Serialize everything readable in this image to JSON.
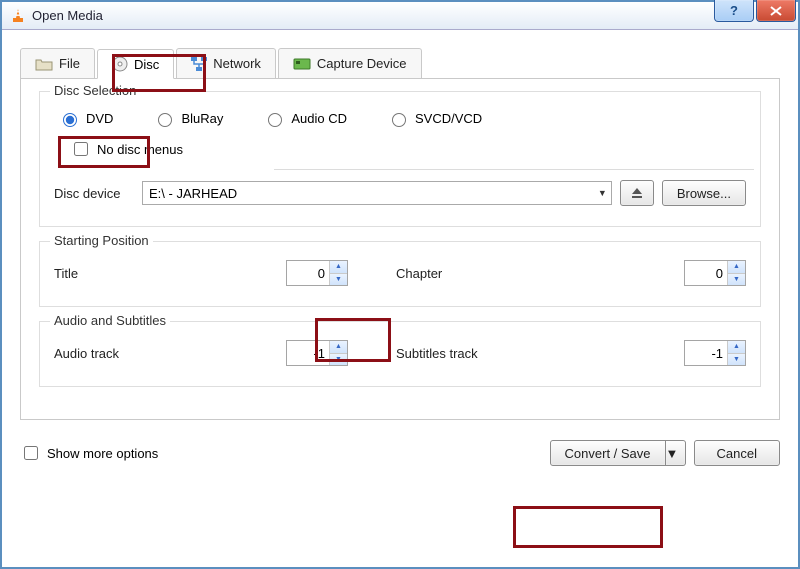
{
  "window": {
    "title": "Open Media"
  },
  "tabs": {
    "file": "File",
    "disc": "Disc",
    "network": "Network",
    "capture": "Capture Device"
  },
  "disc_selection": {
    "legend": "Disc Selection",
    "dvd": "DVD",
    "bluray": "BluRay",
    "audiocd": "Audio CD",
    "svcd": "SVCD/VCD",
    "no_menus": "No disc menus",
    "device_label": "Disc device",
    "device_value": "E:\\ - JARHEAD",
    "browse": "Browse..."
  },
  "starting_position": {
    "legend": "Starting Position",
    "title_label": "Title",
    "title_value": "0",
    "chapter_label": "Chapter",
    "chapter_value": "0"
  },
  "audio_subtitles": {
    "legend": "Audio and Subtitles",
    "audio_label": "Audio track",
    "audio_value": "-1",
    "subs_label": "Subtitles track",
    "subs_value": "-1"
  },
  "footer": {
    "show_more": "Show more options",
    "convert": "Convert / Save",
    "cancel": "Cancel"
  }
}
